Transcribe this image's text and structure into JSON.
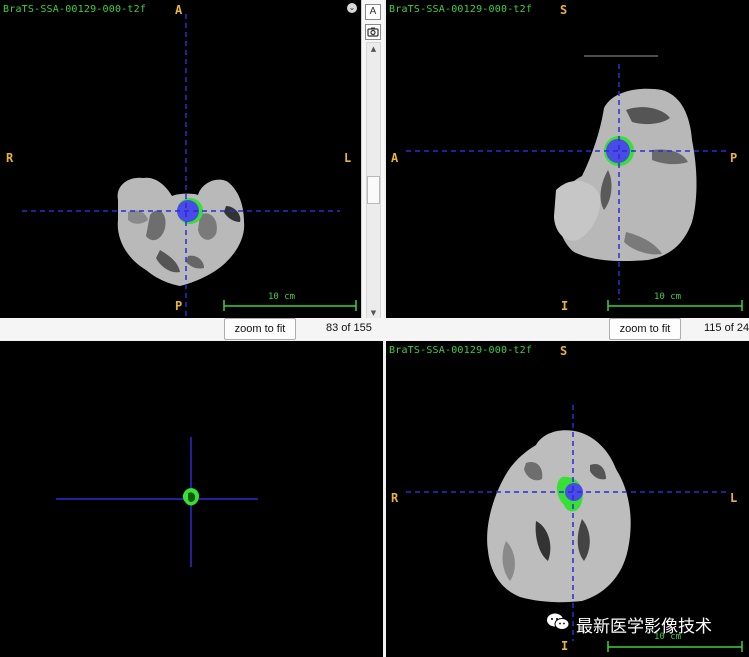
{
  "views": {
    "axial": {
      "title": "BraTS-SSA-00129-000-t2f",
      "orient": {
        "top": "A",
        "left": "R",
        "right": "L",
        "bottom": "P"
      },
      "scale_label": "10 cm"
    },
    "sagittal": {
      "title": "BraTS-SSA-00129-000-t2f",
      "orient": {
        "top": "S",
        "left": "A",
        "right": "P",
        "bottom": "I"
      },
      "scale_label": "10 cm"
    },
    "render3d": {},
    "coronal": {
      "title": "BraTS-SSA-00129-000-t2f",
      "orient": {
        "top": "S",
        "left": "R",
        "right": "L",
        "bottom": "I"
      },
      "scale_label": "10 cm"
    }
  },
  "toolbar": {
    "zoom_label": "zoom to fit",
    "axial_slice": "83 of 155",
    "sagittal_slice": "115 of 24",
    "annotate_icon_label": "A"
  },
  "watermark": {
    "text": "最新医学影像技术",
    "icon": "wechat-icon"
  },
  "colors": {
    "crosshair": "#2b2bd6",
    "label_orange": "#e8b33a",
    "text_green": "#3ed13e",
    "tumor_core": "#4a4ae6",
    "tumor_edema": "#36e036"
  }
}
